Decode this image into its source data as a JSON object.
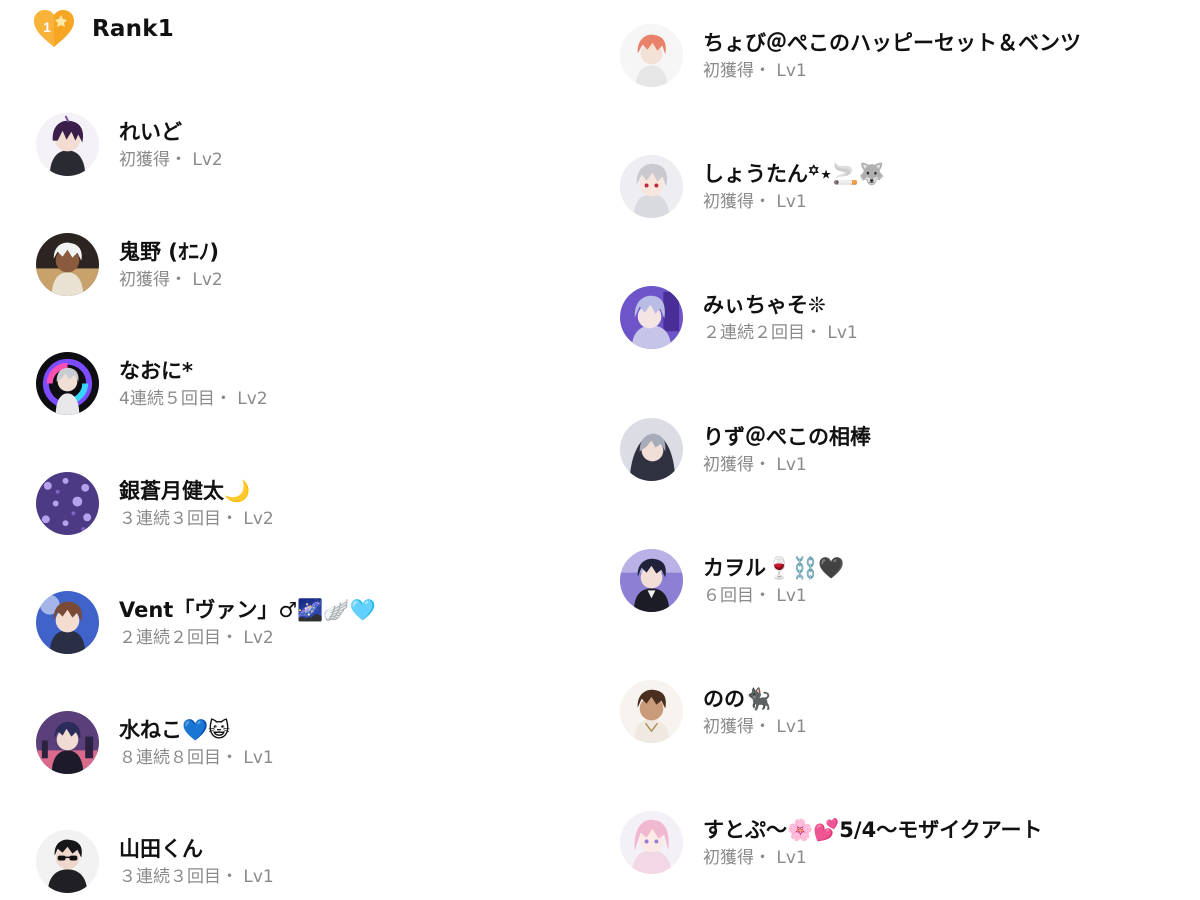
{
  "header": {
    "title": "Rank1",
    "badge_number": "1",
    "badge_color": "#F6A623"
  },
  "left_list": [
    {
      "name": "れいど",
      "sub": "初獲得・ Lv2",
      "avatar": "purple-hair"
    },
    {
      "name": "鬼野 (ｵﾆﾉ)",
      "sub": "初獲得・ Lv2",
      "avatar": "white-hair-dark"
    },
    {
      "name": "なおに*",
      "sub": "4連続５回目・ Lv2",
      "avatar": "neon-ring"
    },
    {
      "name": "銀蒼月健太🌙",
      "sub": "３連続３回目・ Lv2",
      "avatar": "purple-sakura"
    },
    {
      "name": "Vent「ヴァン」♂🌌🪽🩵",
      "sub": "２連続２回目・ Lv2",
      "avatar": "brown-hair-blue"
    },
    {
      "name": "水ねこ💙😺",
      "sub": "８連続８回目・ Lv1",
      "avatar": "night-city"
    },
    {
      "name": "山田くん",
      "sub": "３連続３回目・ Lv1",
      "avatar": "sunglasses"
    }
  ],
  "right_list": [
    {
      "name": "ちょび＠ぺこのハッピーセット＆ベンツ",
      "sub": "初獲得・ Lv1",
      "avatar": "orange-hair"
    },
    {
      "name": "しょうたん꙳⋆🚬🐺",
      "sub": "初獲得・ Lv1",
      "avatar": "silver-hair"
    },
    {
      "name": "みぃちゃそ❊",
      "sub": "２連続２回目・ Lv1",
      "avatar": "lavender-hair"
    },
    {
      "name": "りず＠ぺこの相棒",
      "sub": "初獲得・ Lv1",
      "avatar": "hood-grey"
    },
    {
      "name": "カヲル🍷⛓️🖤",
      "sub": "６回目・ Lv1",
      "avatar": "dark-hair-suit"
    },
    {
      "name": "のの🐈‍⬛",
      "sub": "初獲得・ Lv1",
      "avatar": "brown-hair-boy"
    },
    {
      "name": "すとぷ〜🌸💕5/4〜モザイクアート",
      "sub": "初獲得・ Lv1",
      "avatar": "pink-hair"
    }
  ]
}
